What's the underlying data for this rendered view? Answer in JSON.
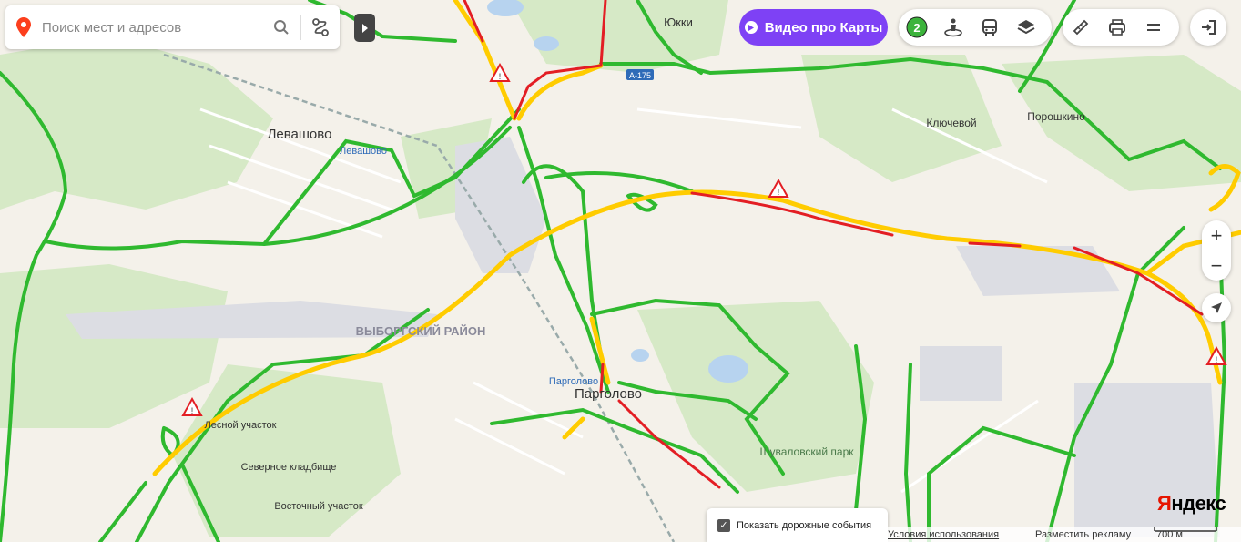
{
  "search": {
    "placeholder": "Поиск мест и адресов"
  },
  "top_buttons": {
    "video_label": "Видео про Карты",
    "traffic_level": "2"
  },
  "map": {
    "labels": {
      "yukki": "Юкки",
      "levashovo": "Левашово",
      "levashovo_station": "Левашово",
      "klyuchevoy": "Ключевой",
      "poroshkino": "Порошкино",
      "vyborgsky_rayon": "ВЫБОРГСКИЙ РАЙОН",
      "pargolovo_station": "Парголово",
      "pargolovo": "Парголово",
      "lesnoy_uchastok": "Лесной участок",
      "severnoe_kladbishche": "Северное кладбище",
      "vostochny_uchastok": "Восточный участок",
      "shuvalovsky_park": "Шуваловский парк"
    },
    "road_number": "А-175"
  },
  "zoom": {
    "plus": "+",
    "minus": "−"
  },
  "events_toggle": {
    "label": "Показать дорожные события",
    "checked": true
  },
  "footer": {
    "terms": "Условия использования",
    "ads": "Разместить рекламу",
    "scale": "700 м"
  },
  "logo": {
    "first": "Я",
    "rest": "ндекс"
  },
  "colors": {
    "traffic_green": "#2fb92f",
    "traffic_yellow": "#ffcc00",
    "traffic_red": "#e31e24",
    "accent": "#7e41f5",
    "forest": "#d6e9c6"
  }
}
